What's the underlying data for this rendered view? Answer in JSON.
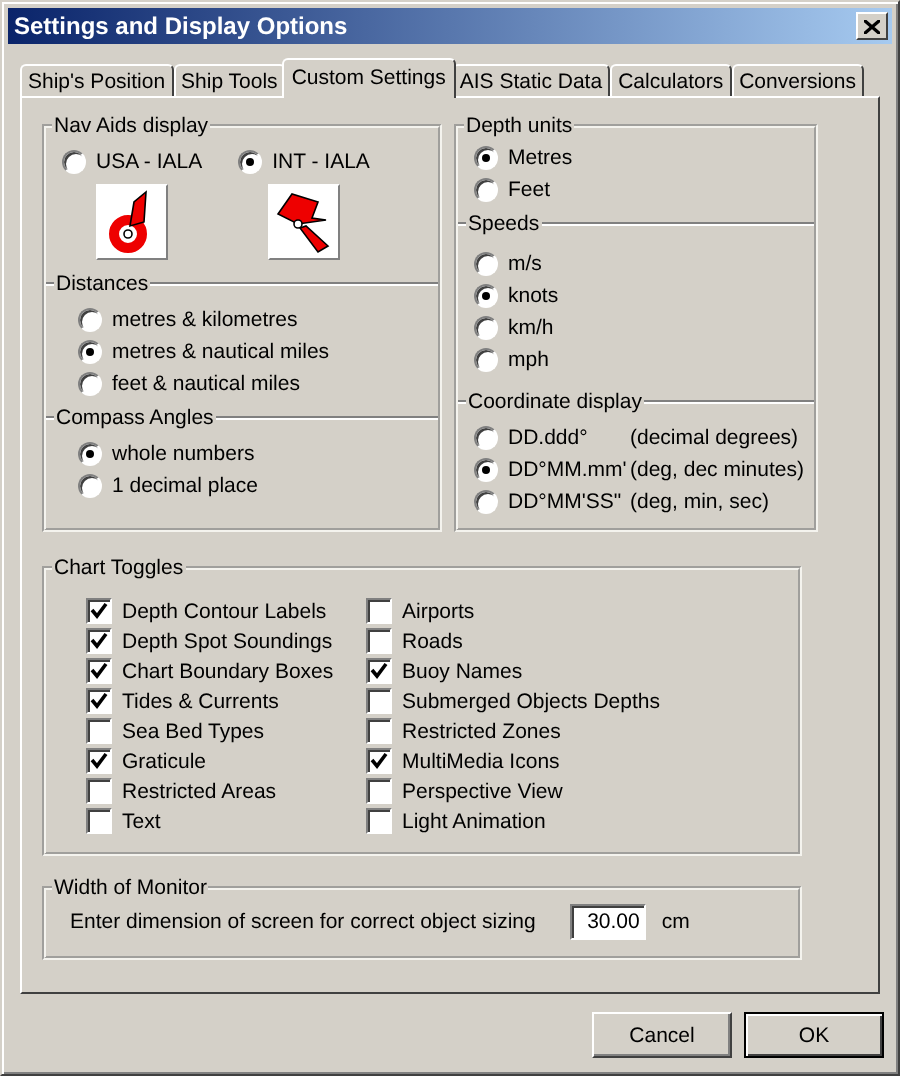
{
  "window": {
    "title": "Settings and Display Options"
  },
  "tabs": [
    {
      "label": "Ship's Position",
      "selected": false
    },
    {
      "label": "Ship Tools",
      "selected": false
    },
    {
      "label": "Custom Settings",
      "selected": true
    },
    {
      "label": "AIS Static Data",
      "selected": false
    },
    {
      "label": "Calculators",
      "selected": false
    },
    {
      "label": "Conversions",
      "selected": false
    }
  ],
  "nav_aids": {
    "title": "Nav Aids display",
    "options": [
      {
        "label": "USA - IALA",
        "selected": false,
        "kind": "usa"
      },
      {
        "label": "INT - IALA",
        "selected": true,
        "kind": "int"
      }
    ]
  },
  "distances": {
    "title": "Distances",
    "options": [
      {
        "label": "metres & kilometres",
        "selected": false
      },
      {
        "label": "metres & nautical miles",
        "selected": true
      },
      {
        "label": "feet & nautical miles",
        "selected": false
      }
    ]
  },
  "compass_angles": {
    "title": "Compass Angles",
    "options": [
      {
        "label": "whole numbers",
        "selected": true
      },
      {
        "label": "1 decimal place",
        "selected": false
      }
    ]
  },
  "depth_units": {
    "title": "Depth units",
    "options": [
      {
        "label": "Metres",
        "selected": true
      },
      {
        "label": "Feet",
        "selected": false
      }
    ]
  },
  "speeds": {
    "title": "Speeds",
    "options": [
      {
        "label": "m/s",
        "selected": false
      },
      {
        "label": "knots",
        "selected": true
      },
      {
        "label": "km/h",
        "selected": false
      },
      {
        "label": "mph",
        "selected": false
      }
    ]
  },
  "coordinate_display": {
    "title": "Coordinate display",
    "options": [
      {
        "label": "DD.ddd°",
        "note": "(decimal degrees)",
        "selected": false
      },
      {
        "label": "DD°MM.mm'",
        "note": "(deg, dec minutes)",
        "selected": true
      },
      {
        "label": "DD°MM'SS\"",
        "note": "(deg, min, sec)",
        "selected": false
      }
    ]
  },
  "chart_toggles": {
    "title": "Chart Toggles",
    "items": [
      {
        "label": "Depth Contour Labels",
        "checked": true
      },
      {
        "label": "Depth Spot Soundings",
        "checked": true
      },
      {
        "label": "Chart Boundary Boxes",
        "checked": true
      },
      {
        "label": "Tides & Currents",
        "checked": true
      },
      {
        "label": "Sea Bed Types",
        "checked": false
      },
      {
        "label": "Graticule",
        "checked": true
      },
      {
        "label": "Restricted Areas",
        "checked": false
      },
      {
        "label": "Text",
        "checked": false
      },
      {
        "label": "Airports",
        "checked": false
      },
      {
        "label": "Roads",
        "checked": false
      },
      {
        "label": "Buoy Names",
        "checked": true
      },
      {
        "label": "Submerged Objects Depths",
        "checked": false
      },
      {
        "label": "Restricted Zones",
        "checked": false
      },
      {
        "label": "MultiMedia Icons",
        "checked": true
      },
      {
        "label": "Perspective View",
        "checked": false
      },
      {
        "label": "Light Animation",
        "checked": false
      }
    ]
  },
  "width_of_monitor": {
    "title": "Width of Monitor",
    "prompt": "Enter dimension of screen for correct object sizing",
    "value": "30.00",
    "unit": "cm"
  },
  "buttons": [
    {
      "label": "Cancel",
      "default": false
    },
    {
      "label": "OK",
      "default": true
    }
  ]
}
